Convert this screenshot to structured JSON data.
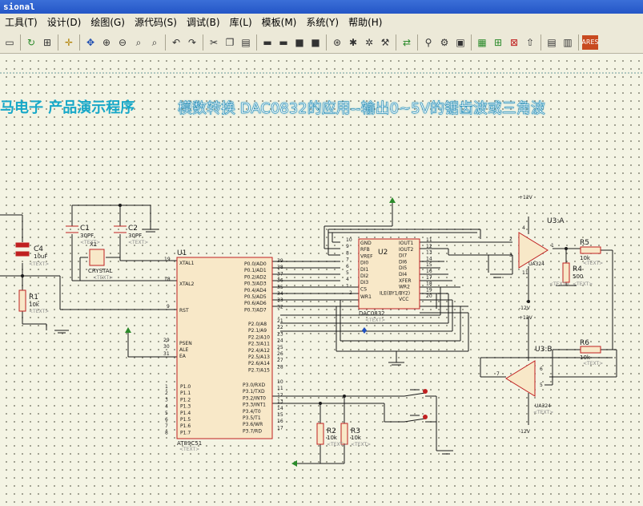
{
  "window": {
    "title_fragment": "sional"
  },
  "menu": [
    "工具(T)",
    "设计(D)",
    "绘图(G)",
    "源代码(S)",
    "调试(B)",
    "库(L)",
    "模板(M)",
    "系统(Y)",
    "帮助(H)"
  ],
  "banner": {
    "left": "马电子  产品演示程序",
    "right": "模数转换 DAC0832的应用--输出0~5V的锯齿波或三角波"
  },
  "schematic": {
    "components": {
      "c1": {
        "ref": "C1",
        "value": "30PF"
      },
      "c2": {
        "ref": "C2",
        "value": "30PF"
      },
      "c4": {
        "ref": "C4",
        "value": "10uF"
      },
      "x1": {
        "ref": "X1",
        "value": "CRYSTAL"
      },
      "r1": {
        "ref": "R1",
        "value": "10k"
      },
      "r2": {
        "ref": "R2",
        "value": "10k"
      },
      "r3": {
        "ref": "R3",
        "value": "10k"
      },
      "r4": {
        "ref": "R4",
        "value": "500"
      },
      "r5": {
        "ref": "R5",
        "value": "10k"
      },
      "r6": {
        "ref": "R6",
        "value": "10k"
      },
      "u1": {
        "ref": "U1",
        "part": "AT89C51"
      },
      "u2": {
        "ref": "U2",
        "part": "DAC0832"
      },
      "u3a": {
        "ref": "U3:A",
        "part": "UA324"
      },
      "u3b": {
        "ref": "U3:B",
        "part": "UA324"
      }
    },
    "text_placeholder": "<TEXT>",
    "supply_pos": "+12V",
    "supply_neg": "-12V",
    "u1_left_pins": {
      "xtal1": {
        "num": "19",
        "name": "XTAL1"
      },
      "xtal2": {
        "num": "18",
        "name": "XTAL2"
      },
      "rst": {
        "num": "9",
        "name": "RST"
      },
      "psen": {
        "num": "29",
        "name": "PSEN"
      },
      "ale": {
        "num": "30",
        "name": "ALE"
      },
      "ea": {
        "num": "31",
        "name": "EA"
      }
    },
    "u1_p1": [
      "P1.0",
      "P1.1",
      "P1.2",
      "P1.3",
      "P1.4",
      "P1.5",
      "P1.6",
      "P1.7"
    ],
    "u1_p1_nums": [
      "1",
      "2",
      "3",
      "4",
      "5",
      "6",
      "7",
      "8"
    ],
    "u1_p0": [
      "P0.0/AD0",
      "P0.1/AD1",
      "P0.2/AD2",
      "P0.3/AD3",
      "P0.4/AD4",
      "P0.5/AD5",
      "P0.6/AD6",
      "P0.7/AD7"
    ],
    "u1_p0_nums": [
      "39",
      "38",
      "37",
      "36",
      "35",
      "34",
      "33",
      "32"
    ],
    "u1_p2": [
      "P2.0/A8",
      "P2.1/A9",
      "P2.2/A10",
      "P2.3/A11",
      "P2.4/A12",
      "P2.5/A13",
      "P2.6/A14",
      "P2.7/A15"
    ],
    "u1_p2_nums": [
      "21",
      "22",
      "23",
      "24",
      "25",
      "26",
      "27",
      "28"
    ],
    "u1_p3": [
      "P3.0/RXD",
      "P3.1/TXD",
      "P3.2/INT0",
      "P3.3/INT1",
      "P3.4/T0",
      "P3.5/T1",
      "P3.6/WR",
      "P3.7/RD"
    ],
    "u1_p3_nums": [
      "10",
      "11",
      "12",
      "13",
      "14",
      "15",
      "16",
      "17"
    ],
    "u2_left": [
      "GND",
      "RFB",
      "VREF",
      "DI0",
      "DI1",
      "DI2",
      "DI3",
      "CS"
    ],
    "u2_left_nums": [
      "10",
      "9",
      "8",
      "7",
      "6",
      "5",
      "4",
      "1"
    ],
    "u2_right": [
      "IOUT1",
      "IOUT2",
      "DI7",
      "DI6",
      "DI5",
      "DI4",
      "XFER",
      "WR2",
      "ILE(BY1/BY2)",
      "VCC"
    ],
    "u2_right_nums": [
      "11",
      "12",
      "13",
      "14",
      "15",
      "16",
      "17",
      "18",
      "19",
      "20"
    ],
    "u2_extra": {
      "wr1": "WR1",
      "num": "2"
    },
    "u3a_pins": {
      "minus": "2",
      "plus": "3",
      "out": "1",
      "vcc": "4",
      "vee": "11"
    },
    "u3b_pins": {
      "minus": "6",
      "plus": "5",
      "out": "7"
    }
  }
}
